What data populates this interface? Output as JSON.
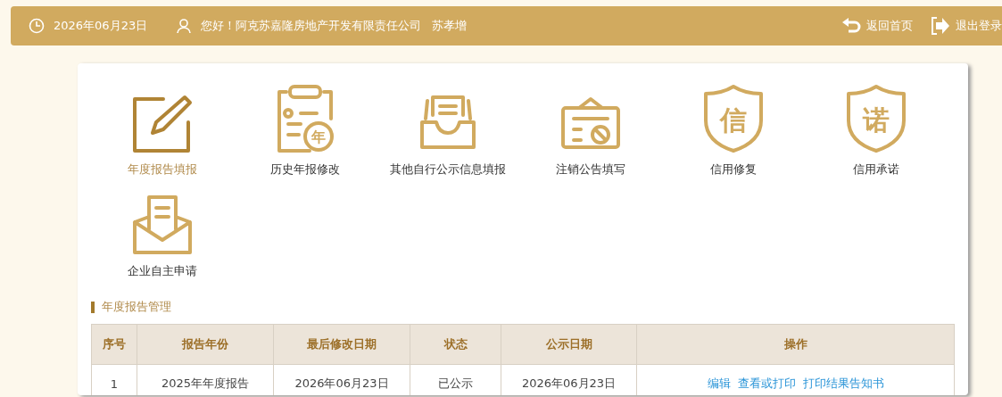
{
  "header": {
    "date": "2026年06月23日",
    "greeting": "您好！阿克苏嘉隆房地产开发有限责任公司",
    "user": "苏孝增",
    "links": [
      {
        "kind": "home",
        "label": "返回首页"
      },
      {
        "kind": "logout",
        "label": "退出登录"
      }
    ]
  },
  "tiles": [
    {
      "kind": "edit",
      "label": "年度报告填报",
      "selected": true
    },
    {
      "kind": "clipboard",
      "label": "历史年报修改",
      "glyph": "年",
      "selected": false
    },
    {
      "kind": "tray",
      "label": "其他自行公示信息填报",
      "selected": false
    },
    {
      "kind": "notice",
      "label": "注销公告填写",
      "selected": false
    },
    {
      "kind": "shield",
      "label": "信用修复",
      "glyph": "信",
      "selected": false
    },
    {
      "kind": "shield",
      "label": "信用承诺",
      "glyph": "诺",
      "selected": false
    },
    {
      "kind": "envelope",
      "label": "企业自主申请",
      "selected": false
    }
  ],
  "section_title": "年度报告管理",
  "table": {
    "columns": [
      "序号",
      "报告年份",
      "最后修改日期",
      "状态",
      "公示日期",
      "操作"
    ],
    "rows": [
      {
        "cells": [
          "1",
          "2025年年度报告",
          "2026年06月23日",
          "已公示",
          "2026年06月23日"
        ],
        "actions": [
          "编辑",
          "查看或打印",
          "打印结果告知书"
        ]
      }
    ]
  }
}
